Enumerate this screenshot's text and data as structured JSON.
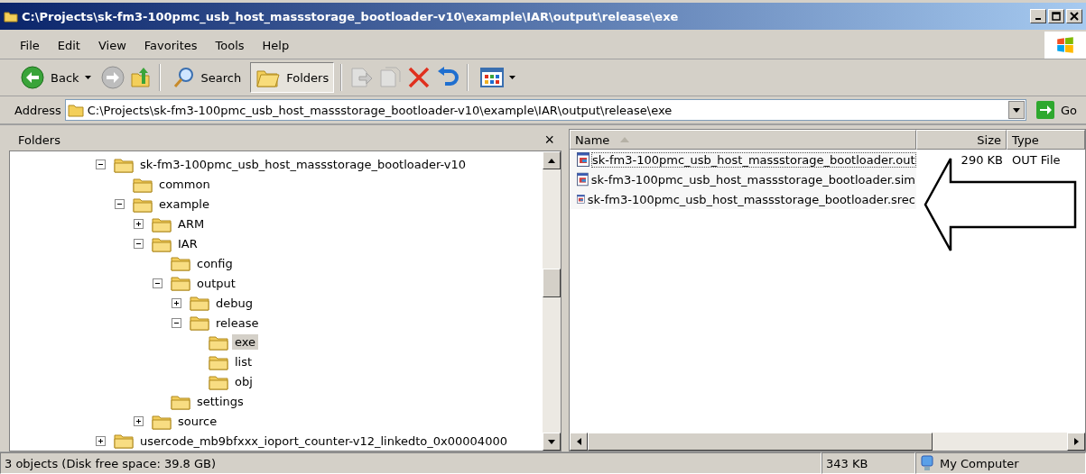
{
  "window": {
    "title": "C:\\Projects\\sk-fm3-100pmc_usb_host_massstorage_bootloader-v10\\example\\IAR\\output\\release\\exe"
  },
  "menu": [
    "File",
    "Edit",
    "View",
    "Favorites",
    "Tools",
    "Help"
  ],
  "toolbar": {
    "back": "Back",
    "search": "Search",
    "folders": "Folders",
    "folders_selected": true
  },
  "address": {
    "label": "Address",
    "value": "C:\\Projects\\sk-fm3-100pmc_usb_host_massstorage_bootloader-v10\\example\\IAR\\output\\release\\exe",
    "go": "Go"
  },
  "folders_pane": {
    "title": "Folders",
    "close": "×",
    "tree": [
      {
        "label": "sk-fm3-100pmc_usb_host_massstorage_bootloader-v10",
        "expanded": true,
        "selected": false,
        "children": [
          {
            "label": "common",
            "selected": false
          },
          {
            "label": "example",
            "expanded": true,
            "selected": false,
            "children": [
              {
                "label": "ARM",
                "expanded": false,
                "selected": false
              },
              {
                "label": "IAR",
                "expanded": true,
                "selected": false,
                "children": [
                  {
                    "label": "config",
                    "selected": false
                  },
                  {
                    "label": "output",
                    "expanded": true,
                    "selected": false,
                    "children": [
                      {
                        "label": "debug",
                        "expanded": false,
                        "selected": false
                      },
                      {
                        "label": "release",
                        "expanded": true,
                        "selected": false,
                        "children": [
                          {
                            "label": "exe",
                            "selected": true
                          },
                          {
                            "label": "list",
                            "selected": false
                          },
                          {
                            "label": "obj",
                            "selected": false
                          }
                        ]
                      }
                    ]
                  },
                  {
                    "label": "settings",
                    "selected": false
                  }
                ]
              },
              {
                "label": "source",
                "expanded": false,
                "selected": false
              }
            ]
          }
        ]
      },
      {
        "label": "usercode_mb9bfxxx_ioport_counter-v12_linkedto_0x00004000",
        "expanded": false,
        "selected": false
      }
    ]
  },
  "file_list": {
    "columns": [
      "Name",
      "Size",
      "Type"
    ],
    "rows": [
      {
        "name": "sk-fm3-100pmc_usb_host_massstorage_bootloader.out",
        "size": "290 KB",
        "type": "OUT File",
        "selected": true
      },
      {
        "name": "sk-fm3-100pmc_usb_host_massstorage_bootloader.sim",
        "selected": false
      },
      {
        "name": "sk-fm3-100pmc_usb_host_massstorage_bootloader.srec",
        "selected": false
      }
    ]
  },
  "status_bar": {
    "objects": "3 objects (Disk free space: 39.8 GB)",
    "size": "343 KB",
    "zone": "My Computer"
  }
}
